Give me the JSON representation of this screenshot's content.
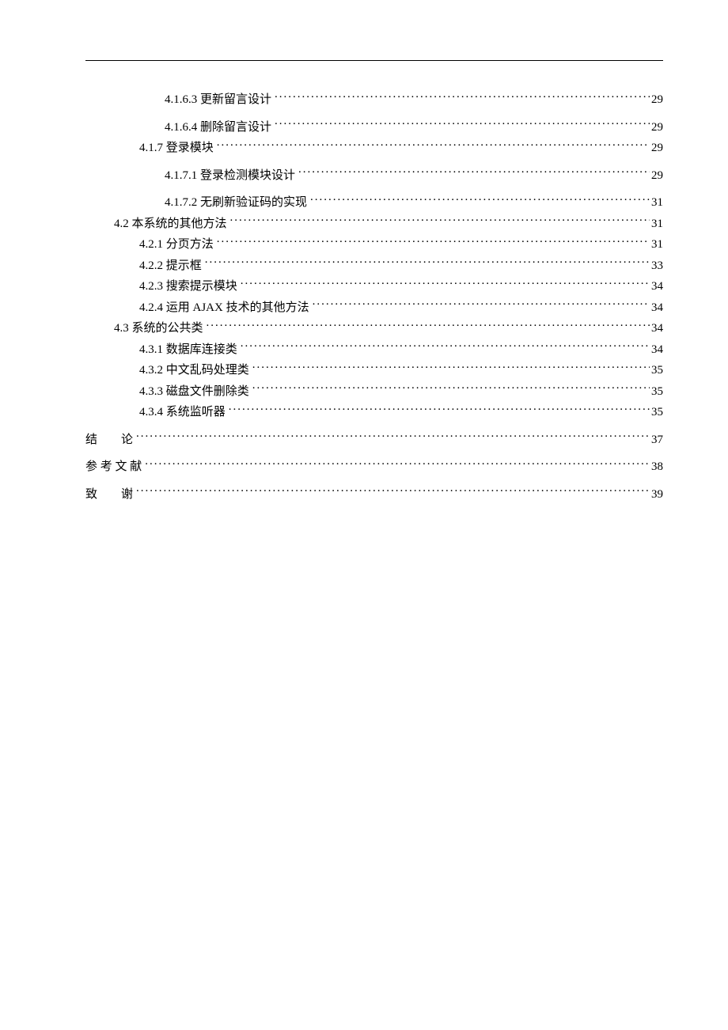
{
  "toc": [
    {
      "level": 3,
      "label": "4.1.6.3 更新留言设计",
      "page": "29",
      "gap": true
    },
    {
      "level": 3,
      "label": "4.1.6.4 删除留言设计",
      "page": "29"
    },
    {
      "level": 2,
      "label": "4.1.7 登录模块 ",
      "page": "29",
      "gap": true
    },
    {
      "level": 3,
      "label": "4.1.7.1 登录检测模块设计",
      "page": "29",
      "gap": true
    },
    {
      "level": 3,
      "label": "4.1.7.2 无刷新验证码的实现",
      "page": "31"
    },
    {
      "level": 1,
      "label": "4.2 本系统的其他方法",
      "page": "31"
    },
    {
      "level": 2,
      "label": "4.2.1 分页方法 ",
      "page": "31"
    },
    {
      "level": 2,
      "label": "4.2.2 提示框 ",
      "page": "33"
    },
    {
      "level": 2,
      "label": "4.2.3 搜索提示模块 ",
      "page": "34"
    },
    {
      "level": 2,
      "label": "4.2.4 运用 AJAX 技术的其他方法 ",
      "page": "34"
    },
    {
      "level": 1,
      "label": "4.3 系统的公共类",
      "page": "34"
    },
    {
      "level": 2,
      "label": "4.3.1 数据库连接类 ",
      "page": "34"
    },
    {
      "level": 2,
      "label": "4.3.2 中文乱码处理类 ",
      "page": "35"
    },
    {
      "level": 2,
      "label": "4.3.3 磁盘文件删除类 ",
      "page": "35"
    },
    {
      "level": 2,
      "label": "4.3.4 系统监听器 ",
      "page": "35",
      "gap": true
    },
    {
      "level": 0,
      "label": "结　　论 ",
      "page": "37",
      "gap": true
    },
    {
      "level": 0,
      "label": "参 考 文 献 ",
      "page": "38",
      "gap": true
    },
    {
      "level": 0,
      "label": "致　　谢 ",
      "page": "39"
    }
  ]
}
